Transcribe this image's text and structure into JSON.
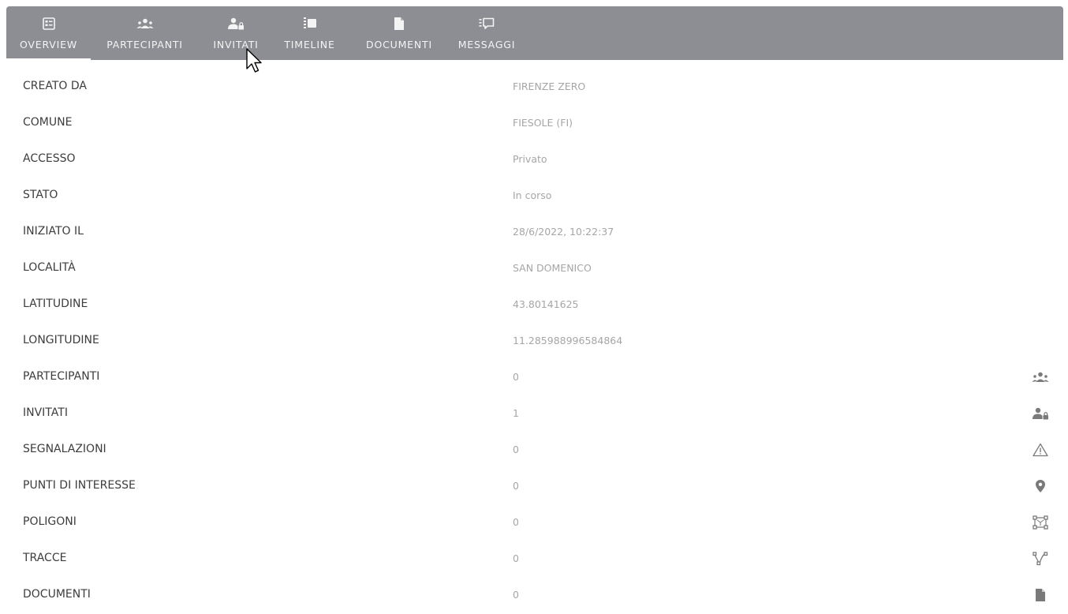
{
  "tabs": [
    {
      "label": "OVERVIEW",
      "icon": "overview-icon",
      "active": true
    },
    {
      "label": "PARTECIPANTI",
      "icon": "participants-icon"
    },
    {
      "label": "INVITATI",
      "icon": "invited-user-icon"
    },
    {
      "label": "TIMELINE",
      "icon": "timeline-icon"
    },
    {
      "label": "DOCUMENTI",
      "icon": "document-icon"
    },
    {
      "label": "MESSAGGI",
      "icon": "message-icon"
    }
  ],
  "overview": {
    "rows": [
      {
        "label": "CREATO DA",
        "value": "FIRENZE ZERO"
      },
      {
        "label": "COMUNE",
        "value": "FIESOLE (FI)"
      },
      {
        "label": "ACCESSO",
        "value": "Privato"
      },
      {
        "label": "STATO",
        "value": "In corso"
      },
      {
        "label": "INIZIATO IL",
        "value": "28/6/2022, 10:22:37"
      },
      {
        "label": "LOCALITÀ",
        "value": "SAN DOMENICO"
      },
      {
        "label": "LATITUDINE",
        "value": "43.80141625"
      },
      {
        "label": "LONGITUDINE",
        "value": "11.285988996584864"
      },
      {
        "label": "PARTECIPANTI",
        "value": "0",
        "icon": "participants-icon"
      },
      {
        "label": "INVITATI",
        "value": "1",
        "icon": "invited-user-icon"
      },
      {
        "label": "SEGNALAZIONI",
        "value": "0",
        "icon": "warning-triangle-icon"
      },
      {
        "label": "PUNTI DI INTERESSE",
        "value": "0",
        "icon": "map-pin-icon"
      },
      {
        "label": "POLIGONI",
        "value": "0",
        "icon": "polygon-icon"
      },
      {
        "label": "TRACCE",
        "value": "0",
        "icon": "track-path-icon"
      },
      {
        "label": "DOCUMENTI",
        "value": "0",
        "icon": "document-icon"
      }
    ]
  },
  "colors": {
    "tabbar": "#8c8e93",
    "tab_text": "#f4f4f4",
    "label_text": "#3d3d3d",
    "value_text": "#a6a6a6",
    "row_icon": "#7a7a7a"
  }
}
